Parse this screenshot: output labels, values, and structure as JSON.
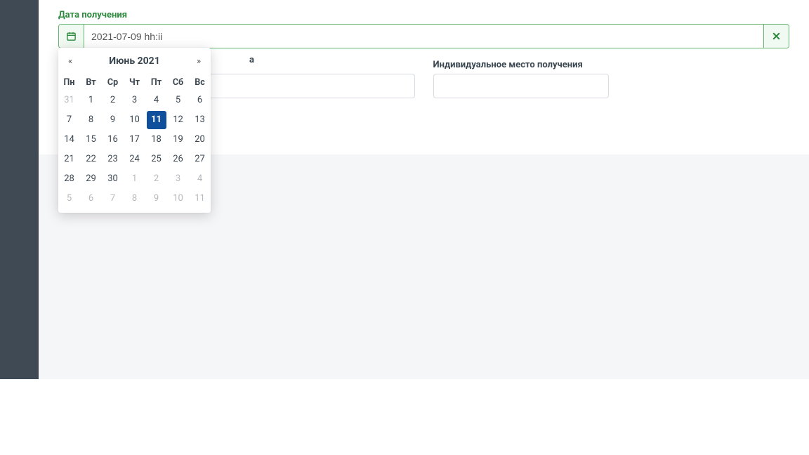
{
  "colors": {
    "accent": "#2d8a3e",
    "selected": "#0f4f9c",
    "sidebar": "#404a55"
  },
  "field": {
    "label": "Дата получения",
    "value": "2021-07-09 hh:ii",
    "placeholder": "2021-07-09 hh:ii"
  },
  "row2": {
    "left_label_tail": "a",
    "right_label": "Индивидуальное место получения"
  },
  "datepicker": {
    "prev": "«",
    "next": "»",
    "title": "Июнь 2021",
    "weekdays": [
      "Пн",
      "Вт",
      "Ср",
      "Чт",
      "Пт",
      "Сб",
      "Вс"
    ],
    "selected_day": 11,
    "weeks": [
      [
        {
          "d": 31,
          "other": true
        },
        {
          "d": 1
        },
        {
          "d": 2
        },
        {
          "d": 3
        },
        {
          "d": 4
        },
        {
          "d": 5
        },
        {
          "d": 6
        }
      ],
      [
        {
          "d": 7
        },
        {
          "d": 8
        },
        {
          "d": 9
        },
        {
          "d": 10
        },
        {
          "d": 11,
          "selected": true
        },
        {
          "d": 12
        },
        {
          "d": 13
        }
      ],
      [
        {
          "d": 14
        },
        {
          "d": 15
        },
        {
          "d": 16
        },
        {
          "d": 17
        },
        {
          "d": 18
        },
        {
          "d": 19
        },
        {
          "d": 20
        }
      ],
      [
        {
          "d": 21
        },
        {
          "d": 22
        },
        {
          "d": 23
        },
        {
          "d": 24
        },
        {
          "d": 25
        },
        {
          "d": 26
        },
        {
          "d": 27
        }
      ],
      [
        {
          "d": 28
        },
        {
          "d": 29
        },
        {
          "d": 30
        },
        {
          "d": 1,
          "other": true
        },
        {
          "d": 2,
          "other": true
        },
        {
          "d": 3,
          "other": true
        },
        {
          "d": 4,
          "other": true
        }
      ],
      [
        {
          "d": 5,
          "other": true
        },
        {
          "d": 6,
          "other": true
        },
        {
          "d": 7,
          "other": true
        },
        {
          "d": 8,
          "other": true
        },
        {
          "d": 9,
          "other": true
        },
        {
          "d": 10,
          "other": true
        },
        {
          "d": 11,
          "other": true
        }
      ]
    ]
  }
}
